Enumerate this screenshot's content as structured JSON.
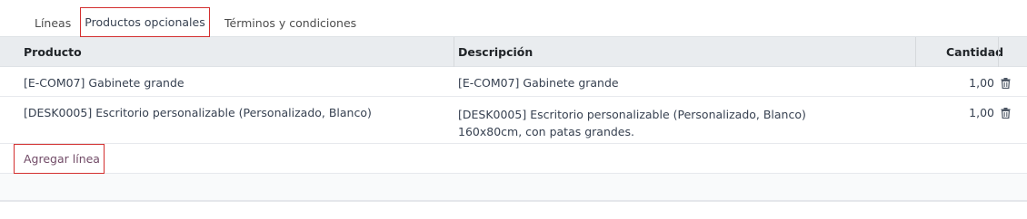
{
  "tabs": [
    {
      "label": "Líneas"
    },
    {
      "label": "Productos opcionales"
    },
    {
      "label": "Términos y condiciones"
    }
  ],
  "table": {
    "headers": {
      "product": "Producto",
      "description": "Descripción",
      "quantity": "Cantidad"
    },
    "rows": [
      {
        "product": "[E-COM07] Gabinete grande",
        "description_line1": "[E-COM07] Gabinete grande",
        "quantity": "1,00"
      },
      {
        "product": "[DESK0005] Escritorio personalizable (Personalizado, Blanco)",
        "description_line1": "[DESK0005] Escritorio personalizable (Personalizado, Blanco)",
        "description_line2": "160x80cm, con patas grandes.",
        "quantity": "1,00"
      }
    ],
    "add_line_label": "Agregar línea",
    "delete_icon": "trash-icon"
  },
  "colors": {
    "highlight_border": "#d32f2f",
    "header_bg": "#e9ecef",
    "link": "#714b67"
  }
}
